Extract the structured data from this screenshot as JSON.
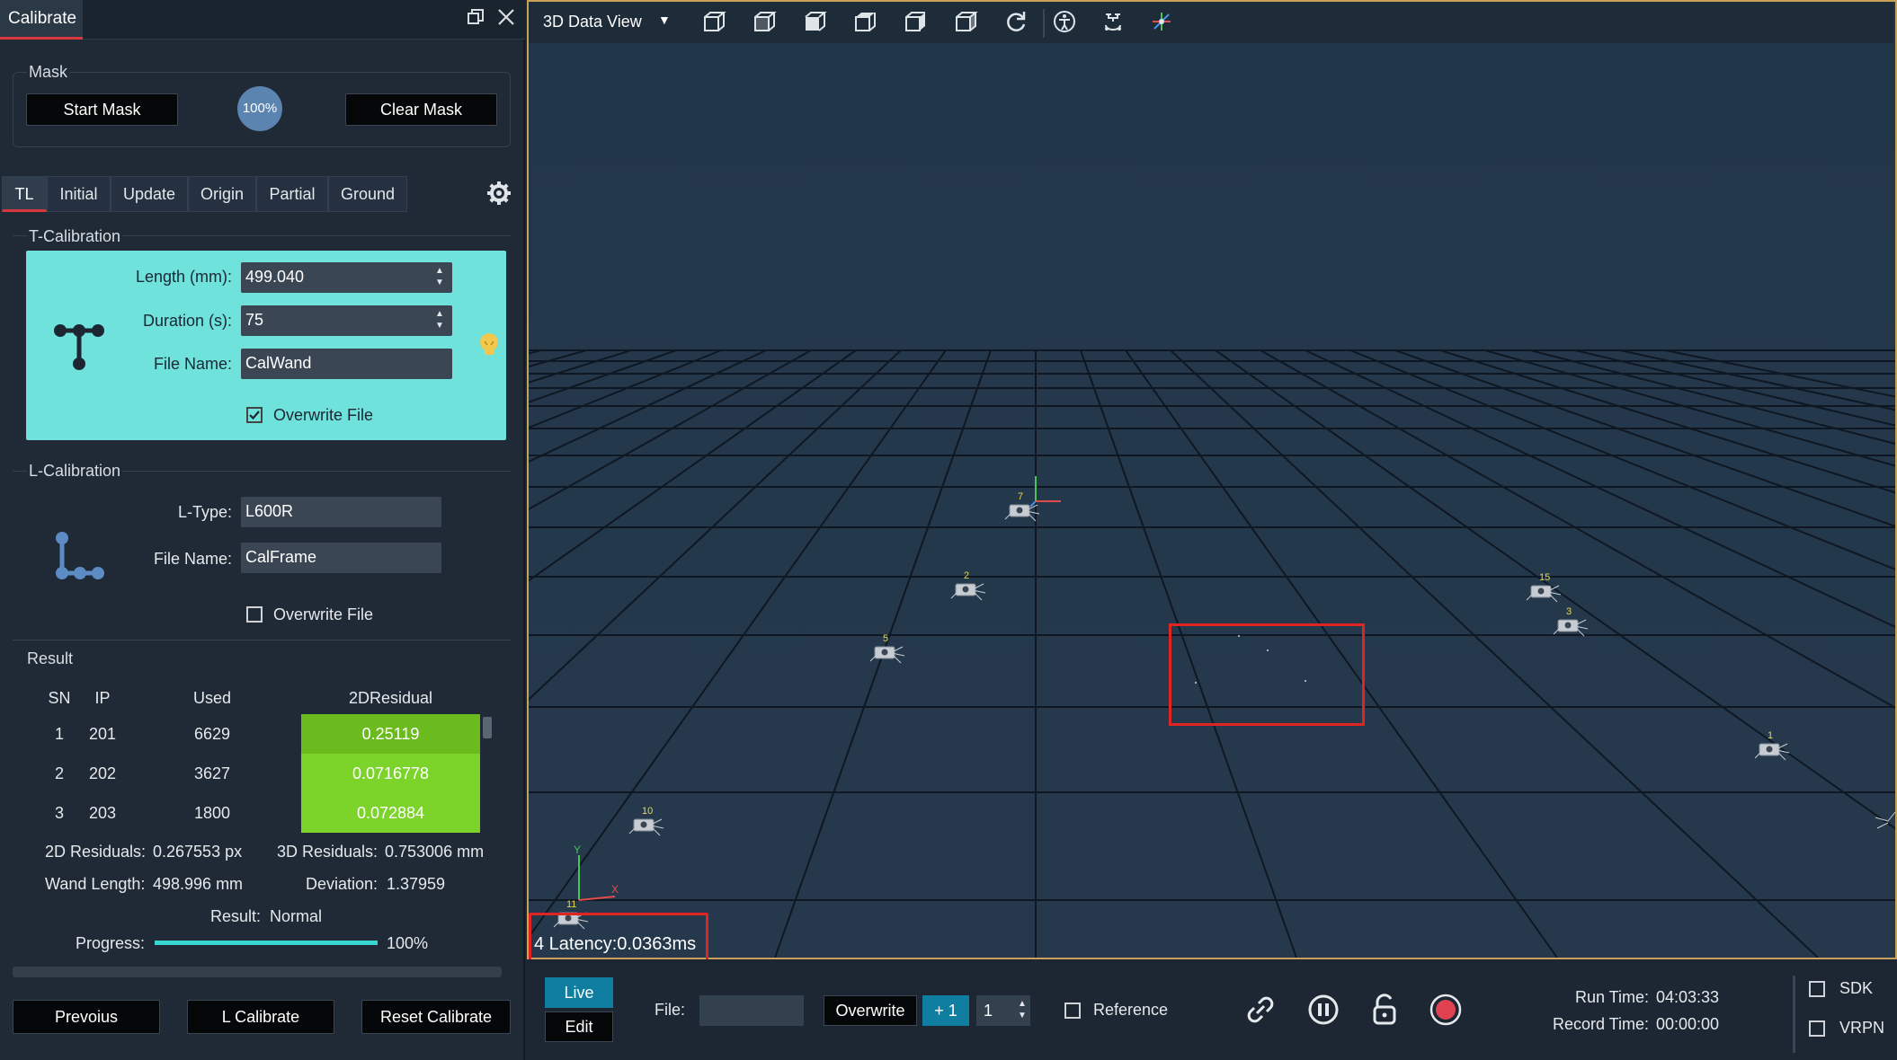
{
  "panel": {
    "tab_title": "Calibrate",
    "mask": {
      "title": "Mask",
      "start_label": "Start Mask",
      "progress_label": "100%",
      "clear_label": "Clear Mask"
    },
    "tabs": [
      "TL",
      "Initial",
      "Update",
      "Origin",
      "Partial",
      "Ground"
    ],
    "t_calibration": {
      "title": "T-Calibration",
      "length_label": "Length (mm):",
      "length_value": "499.040",
      "duration_label": "Duration (s):",
      "duration_value": "75",
      "file_label": "File Name:",
      "file_value": "CalWand",
      "overwrite_label": "Overwrite File",
      "overwrite_checked": true
    },
    "l_calibration": {
      "title": "L-Calibration",
      "type_label": "L-Type:",
      "type_value": "L600R",
      "file_label": "File Name:",
      "file_value": "CalFrame",
      "overwrite_label": "Overwrite File",
      "overwrite_checked": false
    },
    "result": {
      "title": "Result",
      "columns": [
        "SN",
        "IP",
        "Used",
        "2DResidual"
      ],
      "rows": [
        {
          "sn": "1",
          "ip": "201",
          "used": "6629",
          "res": "0.25119"
        },
        {
          "sn": "2",
          "ip": "202",
          "used": "3627",
          "res": "0.0716778"
        },
        {
          "sn": "3",
          "ip": "203",
          "used": "1800",
          "res": "0.072884"
        }
      ],
      "res2d_label": "2D Residuals:",
      "res2d_value": "0.267553 px",
      "res3d_label": "3D Residuals:",
      "res3d_value": "0.753006 mm",
      "wand_label": "Wand Length:",
      "wand_value": "498.996 mm",
      "dev_label": "Deviation:",
      "dev_value": "1.37959",
      "result_label": "Result:",
      "result_value": "Normal",
      "progress_label": "Progress:",
      "progress_value": "100%",
      "progress_fraction": 1.0
    },
    "buttons": {
      "previous": "Prevoius",
      "l_calibrate": "L Calibrate",
      "reset": "Reset Calibrate"
    }
  },
  "view": {
    "dropdown_label": "3D Data View",
    "toolbar_icons": [
      "cube-front-icon",
      "cube-left-icon",
      "cube-solid-icon",
      "cube-top-icon",
      "cube-right-icon",
      "cube-back-icon",
      "refresh-icon",
      "skeleton-icon",
      "drone-icon",
      "axis-icon"
    ],
    "cameras": [
      "7",
      "2",
      "15",
      "3",
      "5",
      "1",
      "10",
      "11"
    ],
    "latency_text": "4 Latency:0.0363ms",
    "axis_labels": {
      "y": "Y",
      "x": "X"
    }
  },
  "bottom": {
    "live_label": "Live",
    "edit_label": "Edit",
    "file_label": "File:",
    "file_value": "",
    "overwrite_label": "Overwrite",
    "plus_label": "+ 1",
    "spin_value": "1",
    "reference_label": "Reference",
    "run_time_label": "Run Time:",
    "run_time_value": "04:03:33",
    "record_time_label": "Record Time:",
    "record_time_value": "00:00:00",
    "sdk_label": "SDK",
    "vrpn_label": "VRPN"
  },
  "colors": {
    "accent_red": "#d9363e",
    "teal_panel": "#6fe2dc",
    "residual_green": "#7cd32a",
    "highlight_red": "#e02424",
    "view_border": "#c9a15a"
  }
}
